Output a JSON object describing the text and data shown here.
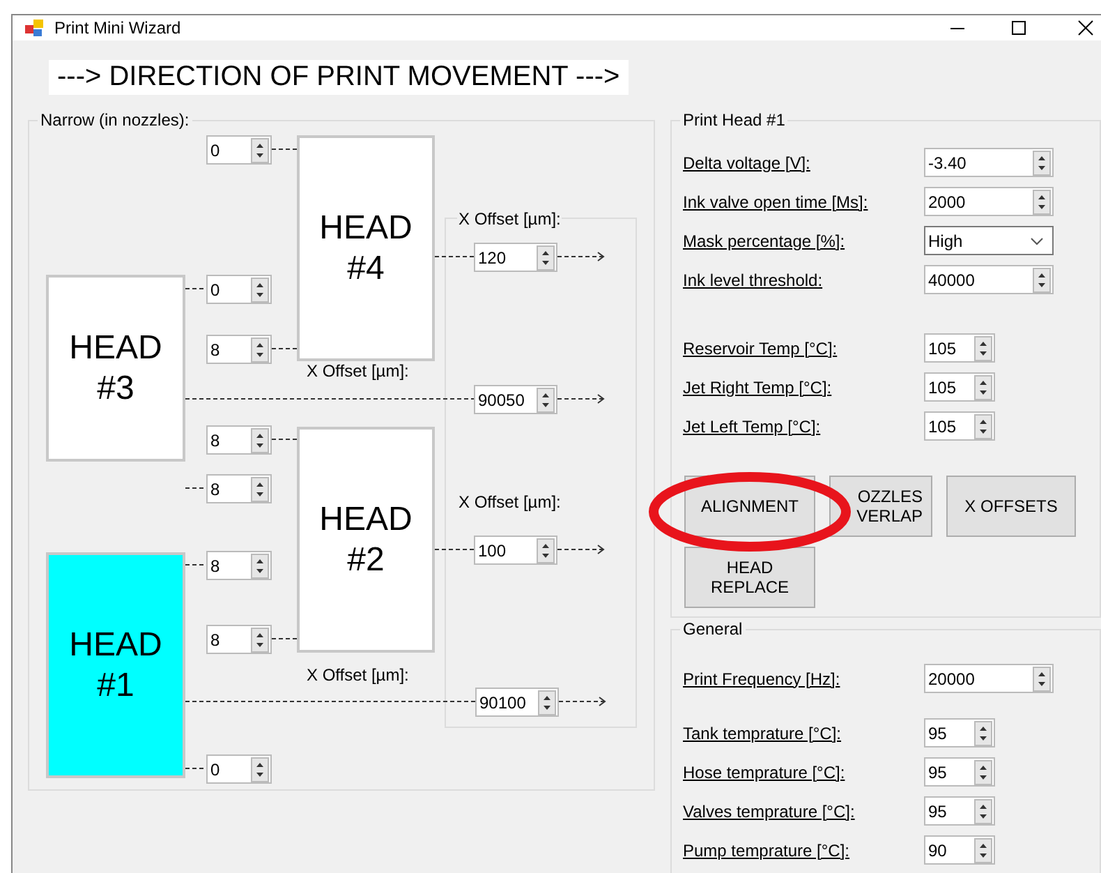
{
  "window": {
    "title": "Print Mini Wizard"
  },
  "banner": "---> DIRECTION OF PRINT MOVEMENT --->",
  "narrow_group": {
    "title": "Narrow (in nozzles):",
    "heads": [
      {
        "label": "HEAD #4",
        "selected": false
      },
      {
        "label": "HEAD #3",
        "selected": false
      },
      {
        "label": "HEAD #2",
        "selected": false
      },
      {
        "label": "HEAD #1",
        "selected": true
      }
    ],
    "narrow_values": [
      "0",
      "0",
      "8",
      "8",
      "8",
      "8",
      "8",
      "0"
    ],
    "offset_group_title": "X Offset [µm]:",
    "offsets": [
      {
        "value": "120"
      },
      {
        "label": "X Offset [µm]:",
        "value": "90050"
      },
      {
        "label": "X Offset [µm]:",
        "value": "100"
      },
      {
        "label": "X Offset [µm]:",
        "value": "90100"
      }
    ]
  },
  "print_head": {
    "title": "Print Head #1",
    "fields": [
      {
        "label": "Delta voltage [V]:",
        "kind": "spin",
        "value": "-3.40"
      },
      {
        "label": "Ink valve open time [Ms]:",
        "kind": "spin",
        "value": "2000"
      },
      {
        "label": "Mask percentage [%]:",
        "kind": "dropdown",
        "value": "High"
      },
      {
        "label": "Ink level threshold:",
        "kind": "spin",
        "value": "40000"
      }
    ],
    "temps": [
      {
        "label": "Reservoir Temp [°C]:",
        "value": "105"
      },
      {
        "label": "Jet Right Temp [°C]:",
        "value": "105"
      },
      {
        "label": "Jet Left Temp [°C]:",
        "value": "105"
      }
    ],
    "buttons": [
      "ALIGNMENT",
      "OZZLES VERLAP",
      "X OFFSETS",
      "HEAD REPLACE"
    ]
  },
  "general": {
    "title": "General",
    "fields": [
      {
        "label": "Print Frequency [Hz]:",
        "value": "20000"
      }
    ],
    "temps": [
      {
        "label": "Tank temprature [°C]:",
        "value": "95"
      },
      {
        "label": "Hose temprature [°C]:",
        "value": "95"
      },
      {
        "label": "Valves temprature [°C]:",
        "value": "95"
      },
      {
        "label": "Pump temprature [°C]:",
        "value": "90"
      }
    ]
  }
}
